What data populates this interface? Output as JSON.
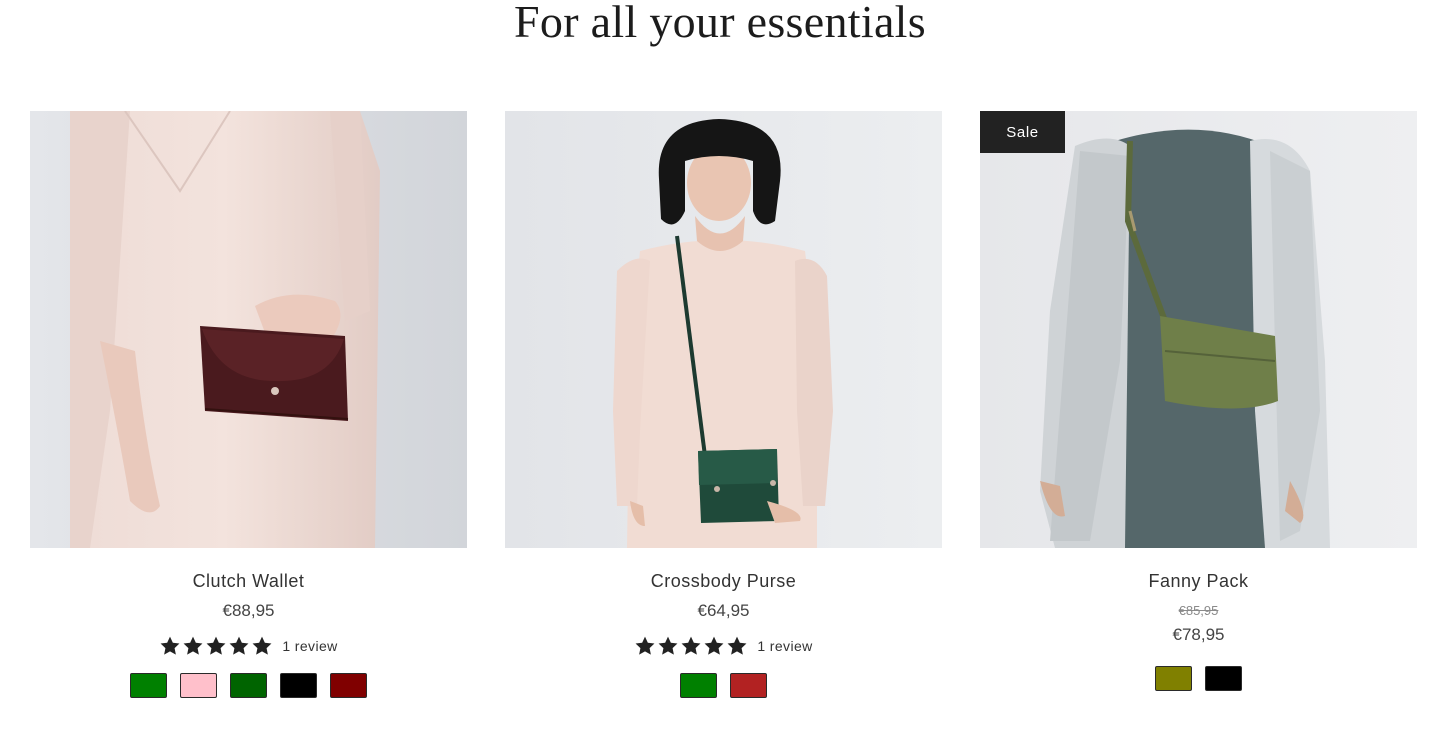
{
  "section": {
    "title": "For all your essentials"
  },
  "products": [
    {
      "title": "Clutch Wallet",
      "price": "€88,95",
      "badge": "",
      "rating": {
        "value": 5,
        "max": 5,
        "reviews_label": "1 review"
      },
      "swatches": [
        "#008000",
        "#ffc0cb",
        "#006400",
        "#000000",
        "#800000"
      ]
    },
    {
      "title": "Crossbody Purse",
      "price": "€64,95",
      "badge": "",
      "rating": {
        "value": 5,
        "max": 5,
        "reviews_label": "1 review"
      },
      "swatches": [
        "#008000",
        "#b22222"
      ]
    },
    {
      "title": "Fanny Pack",
      "compare_price": "€85,95",
      "price": "€78,95",
      "badge": "Sale",
      "swatches": [
        "#808000",
        "#000000"
      ]
    }
  ]
}
